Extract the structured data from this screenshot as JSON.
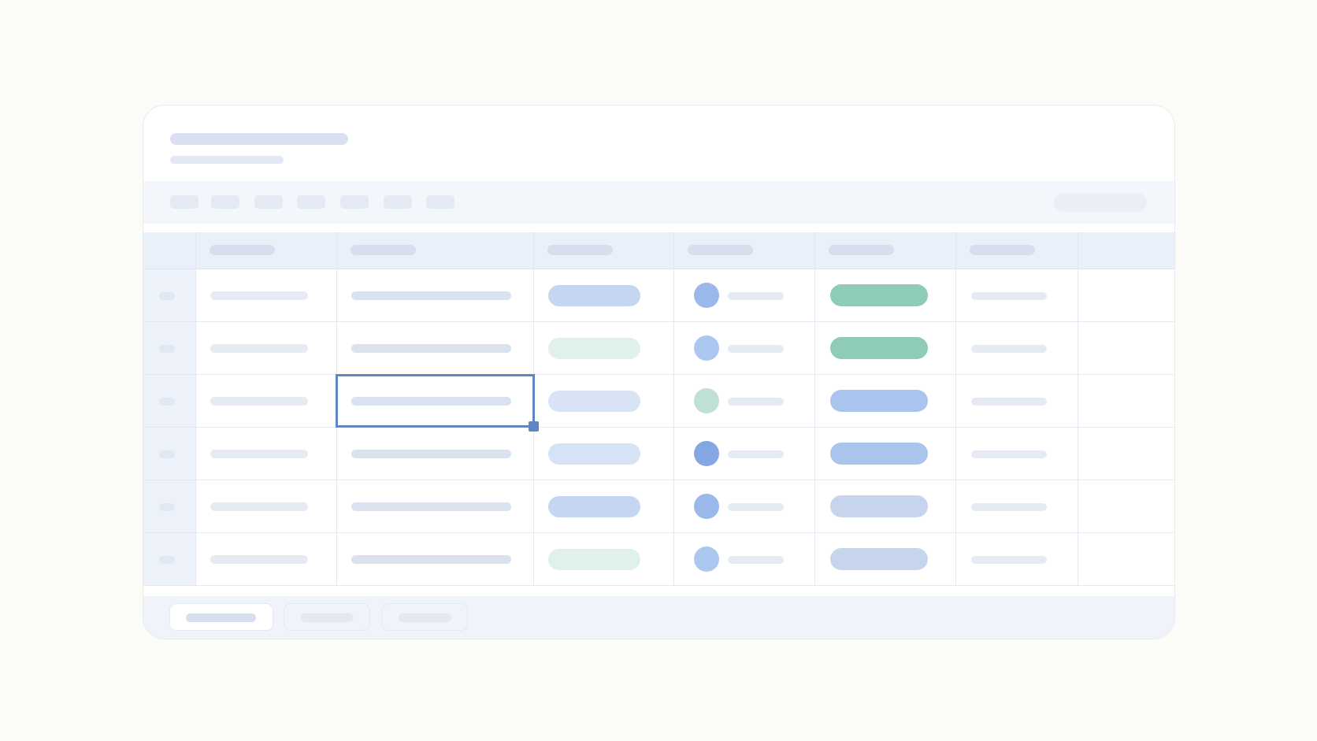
{
  "header": {
    "title": "",
    "subtitle": ""
  },
  "toolbar": {
    "tools": [
      "",
      "",
      "",
      "",
      "",
      "",
      ""
    ],
    "search_placeholder": ""
  },
  "table": {
    "columns": [
      "",
      "",
      "",
      "",
      "",
      ""
    ],
    "rows": [
      {
        "num": "",
        "a": "",
        "b": "",
        "chip": "",
        "chip_color": "#c7d6f0",
        "avatar_color": "#9bb8ea",
        "owner": "",
        "status": "",
        "status_color": "#8fccb6",
        "f": ""
      },
      {
        "num": "",
        "a": "",
        "b": "",
        "chip": "",
        "chip_color": "#e0f1ec",
        "avatar_color": "#abc6ef",
        "owner": "",
        "status": "",
        "status_color": "#8fccb6",
        "f": ""
      },
      {
        "num": "",
        "a": "",
        "b": "",
        "chip": "",
        "chip_color": "#d8e4f5",
        "avatar_color": "#bfe0d7",
        "owner": "",
        "status": "",
        "status_color": "#a9c5ee",
        "f": ""
      },
      {
        "num": "",
        "a": "",
        "b": "",
        "chip": "",
        "chip_color": "#d6e2f5",
        "avatar_color": "#84a7e4",
        "owner": "",
        "status": "",
        "status_color": "#a9c5ee",
        "f": ""
      },
      {
        "num": "",
        "a": "",
        "b": "",
        "chip": "",
        "chip_color": "#c7d6f0",
        "avatar_color": "#9bb8ea",
        "owner": "",
        "status": "",
        "status_color": "#c6d5ec",
        "f": ""
      },
      {
        "num": "",
        "a": "",
        "b": "",
        "chip": "",
        "chip_color": "#e0f1ec",
        "avatar_color": "#abc6ef",
        "owner": "",
        "status": "",
        "status_color": "#c6d5ec",
        "f": ""
      }
    ],
    "selected_cell": {
      "row": 3,
      "column": 2
    }
  },
  "footer": {
    "tabs": [
      "",
      "",
      ""
    ]
  },
  "colors": {
    "accent": "#5f86c2",
    "background": "#fbfbf7",
    "card": "#ffffff",
    "skeleton": "#dae2ef"
  }
}
